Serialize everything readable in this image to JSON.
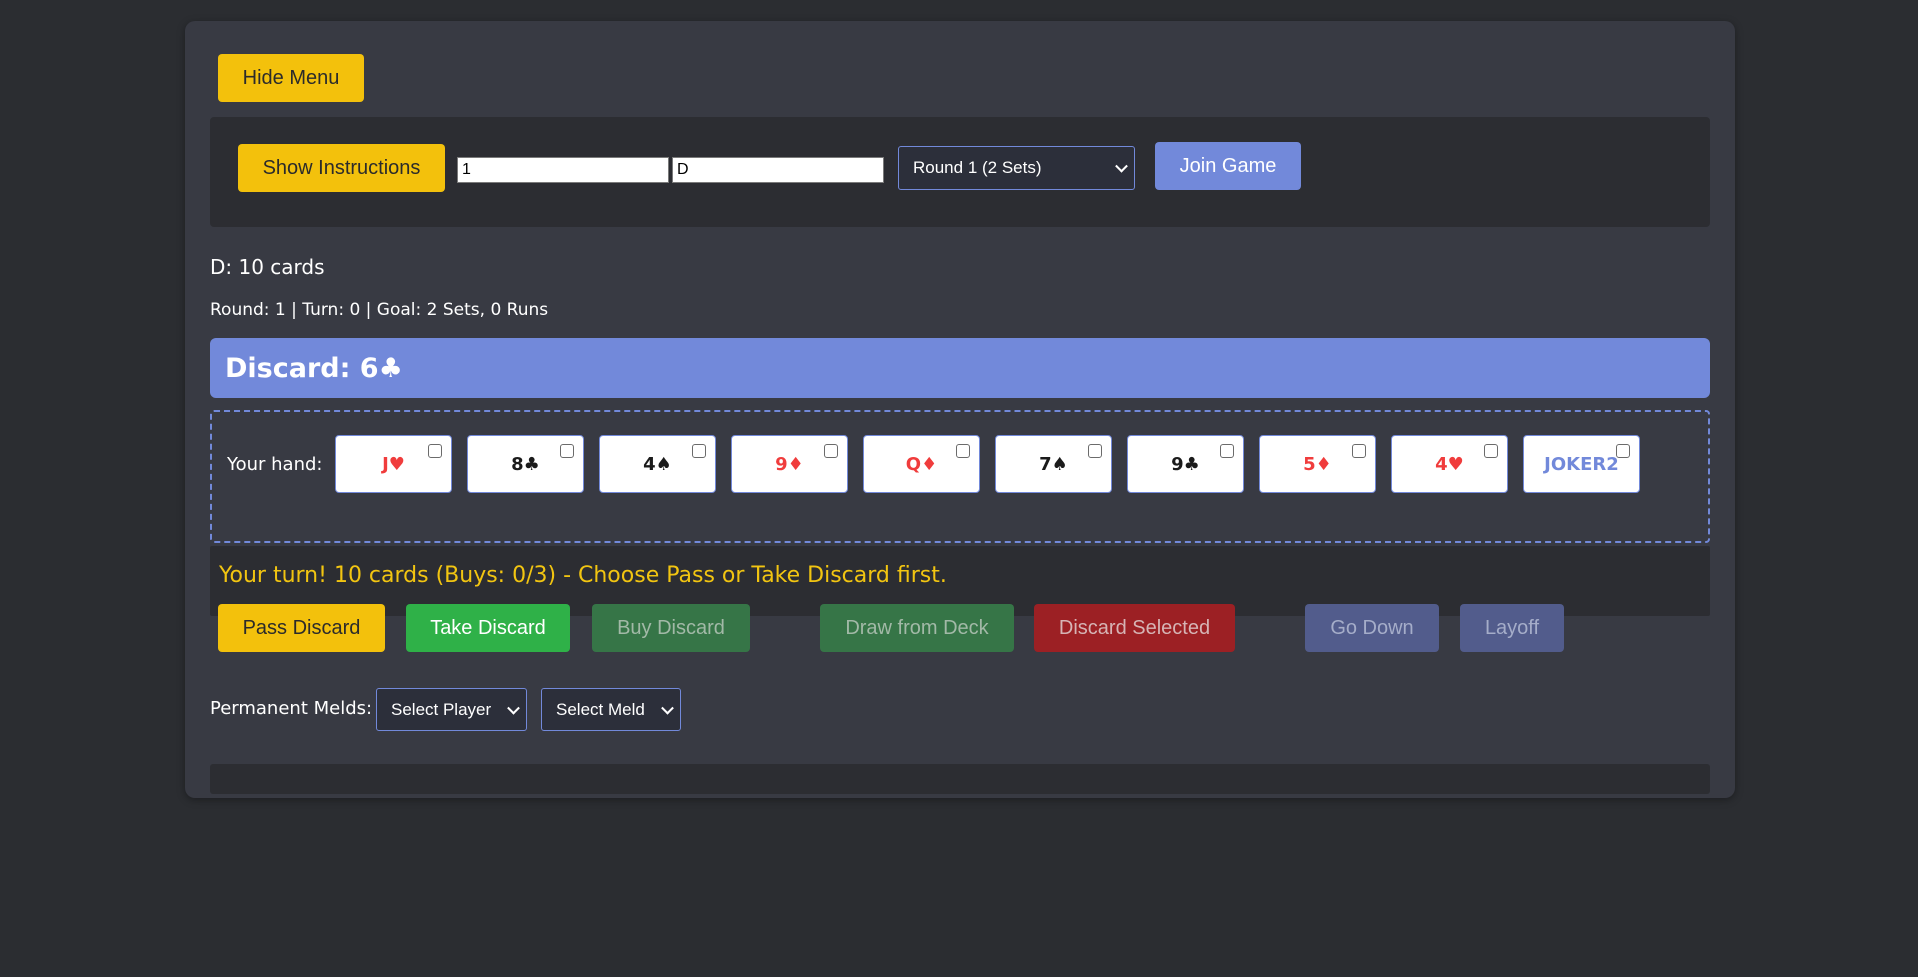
{
  "menu": {
    "hide_label": "Hide Menu"
  },
  "setup": {
    "instructions_label": "Show Instructions",
    "room_value": "1",
    "name_value": "D",
    "round_selected": "Round 1 (2 Sets)",
    "join_label": "Join Game"
  },
  "player_info": "D: 10 cards",
  "status": "Round: 1 | Turn: 0 | Goal: 2 Sets, 0 Runs",
  "discard": {
    "label": "Discard: 6♣"
  },
  "hand": {
    "label": "Your hand:",
    "cards": [
      {
        "text": "J♥",
        "color": "#f03c3c",
        "selected": false
      },
      {
        "text": "8♣",
        "color": "#1b1b1b",
        "selected": false
      },
      {
        "text": "4♠",
        "color": "#1b1b1b",
        "selected": false
      },
      {
        "text": "9♦",
        "color": "#f03c3c",
        "selected": false
      },
      {
        "text": "Q♦",
        "color": "#f03c3c",
        "selected": false
      },
      {
        "text": "7♠",
        "color": "#1b1b1b",
        "selected": false
      },
      {
        "text": "9♣",
        "color": "#1b1b1b",
        "selected": false
      },
      {
        "text": "5♦",
        "color": "#f03c3c",
        "selected": false
      },
      {
        "text": "4♥",
        "color": "#f03c3c",
        "selected": false
      },
      {
        "text": "JOKER2",
        "color": "#7289da",
        "selected": false
      }
    ]
  },
  "turn_message": "Your turn! 10 cards (Buys: 0/3) - Choose Pass or Take Discard first.",
  "actions": {
    "pass_label": "Pass Discard",
    "take_label": "Take Discard",
    "buy_label": "Buy Discard",
    "draw_label": "Draw from Deck",
    "discard_selected_label": "Discard Selected",
    "go_down_label": "Go Down",
    "layoff_label": "Layoff"
  },
  "melds": {
    "label": "Permanent Melds:",
    "player_selected": "Select Player",
    "meld_selected": "Select Meld"
  },
  "colors": {
    "accent_blue": "#7289da",
    "accent_yellow": "#f3c10c",
    "success_green": "#2fb148",
    "danger_red": "#9c2024",
    "card_red": "#f03c3c",
    "card_black": "#1b1b1b"
  }
}
